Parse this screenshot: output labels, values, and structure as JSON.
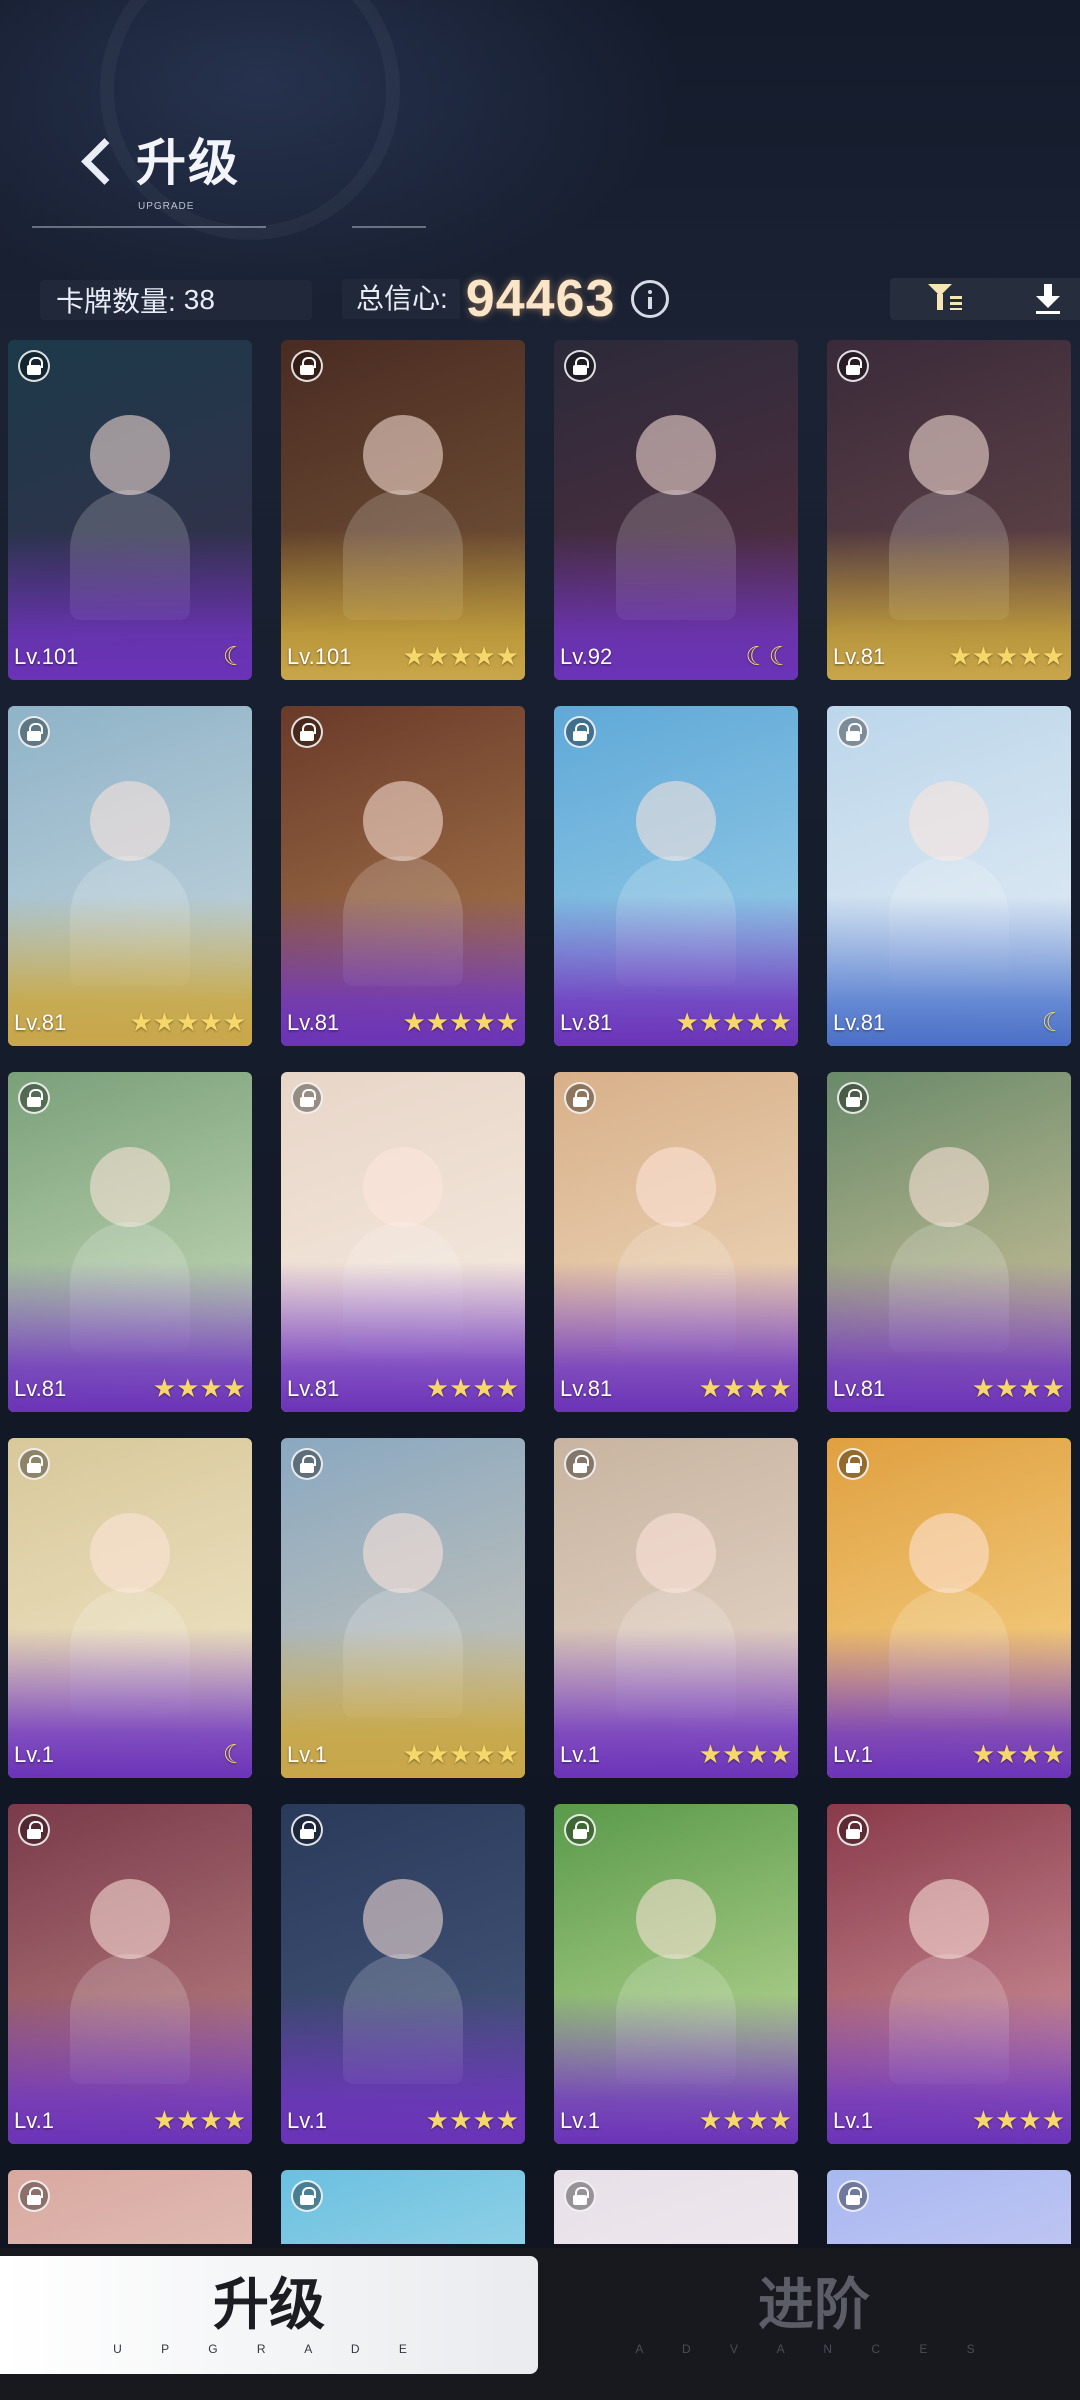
{
  "header": {
    "title": "升级",
    "subtitle": "UPGRADE",
    "card_count_label": "卡牌数量:",
    "card_count": "38",
    "total_label": "总信心:",
    "total_value": "94463"
  },
  "cards": [
    {
      "level": "Lv.101",
      "rank": "☾",
      "frame": "purple",
      "art": [
        "#1c3a4a",
        "#3a2e4a"
      ]
    },
    {
      "level": "Lv.101",
      "rank": "★★★★★",
      "frame": "gold",
      "art": [
        "#4a2b22",
        "#7a5a3a"
      ]
    },
    {
      "level": "Lv.92",
      "rank": "☾☾",
      "frame": "purple",
      "art": [
        "#2b2a3a",
        "#5a3040"
      ]
    },
    {
      "level": "Lv.81",
      "rank": "★★★★★",
      "frame": "gold",
      "art": [
        "#3a2a3a",
        "#6a4a4a"
      ]
    },
    {
      "level": "Lv.81",
      "rank": "★★★★★",
      "frame": "gold",
      "art": [
        "#8fb3c8",
        "#c9d8de"
      ]
    },
    {
      "level": "Lv.81",
      "rank": "★★★★★",
      "frame": "purple",
      "art": [
        "#6a3a2a",
        "#b08050"
      ]
    },
    {
      "level": "Lv.81",
      "rank": "★★★★★",
      "frame": "purple",
      "art": [
        "#5fa9d8",
        "#9fd0e8"
      ]
    },
    {
      "level": "Lv.81",
      "rank": "☾",
      "frame": "blue",
      "art": [
        "#bcd6ea",
        "#e6eef6"
      ]
    },
    {
      "level": "Lv.81",
      "rank": "★★★★",
      "frame": "purple",
      "art": [
        "#7aa07a",
        "#cfe0c0"
      ]
    },
    {
      "level": "Lv.81",
      "rank": "★★★★",
      "frame": "purple",
      "art": [
        "#e8d6c8",
        "#f6ece2"
      ]
    },
    {
      "level": "Lv.81",
      "rank": "★★★★",
      "frame": "purple",
      "art": [
        "#d8b08a",
        "#f0dcc0"
      ]
    },
    {
      "level": "Lv.81",
      "rank": "★★★★",
      "frame": "purple",
      "art": [
        "#6a8a6a",
        "#d8c8a0"
      ]
    },
    {
      "level": "Lv.1",
      "rank": "☾",
      "frame": "purple",
      "art": [
        "#d8c89a",
        "#f2e8cc"
      ]
    },
    {
      "level": "Lv.1",
      "rank": "★★★★★",
      "frame": "gold",
      "art": [
        "#8aa8c0",
        "#d0c8b8"
      ]
    },
    {
      "level": "Lv.1",
      "rank": "★★★★",
      "frame": "purple",
      "art": [
        "#c8b4a0",
        "#e8d8cc"
      ]
    },
    {
      "level": "Lv.1",
      "rank": "★★★★",
      "frame": "purple",
      "art": [
        "#e0a040",
        "#f8d890"
      ]
    },
    {
      "level": "Lv.1",
      "rank": "★★★★",
      "frame": "purple",
      "art": [
        "#7a3a4a",
        "#c08a8a"
      ]
    },
    {
      "level": "Lv.1",
      "rank": "★★★★",
      "frame": "purple",
      "art": [
        "#2a3a5a",
        "#4a5a80"
      ]
    },
    {
      "level": "Lv.1",
      "rank": "★★★★",
      "frame": "purple",
      "art": [
        "#5a9a4a",
        "#c8e0a0"
      ]
    },
    {
      "level": "Lv.1",
      "rank": "★★★★",
      "frame": "purple",
      "art": [
        "#8a3a4a",
        "#d8a0a8"
      ]
    },
    {
      "level": "",
      "rank": "",
      "frame": "none",
      "art": [
        "#d8a8a0",
        "#f0d8d0"
      ]
    },
    {
      "level": "",
      "rank": "",
      "frame": "none",
      "art": [
        "#6ac0e0",
        "#c8e8f0"
      ]
    },
    {
      "level": "",
      "rank": "",
      "frame": "none",
      "art": [
        "#e8e0e8",
        "#f6f2f6"
      ]
    },
    {
      "level": "",
      "rank": "",
      "frame": "none",
      "art": [
        "#a8b8f0",
        "#e0d8f8"
      ]
    }
  ],
  "tabs": {
    "upgrade_label": "升级",
    "upgrade_sub": "U P G R A D E",
    "advances_label": "进阶",
    "advances_sub": "A D V A N C E S"
  }
}
